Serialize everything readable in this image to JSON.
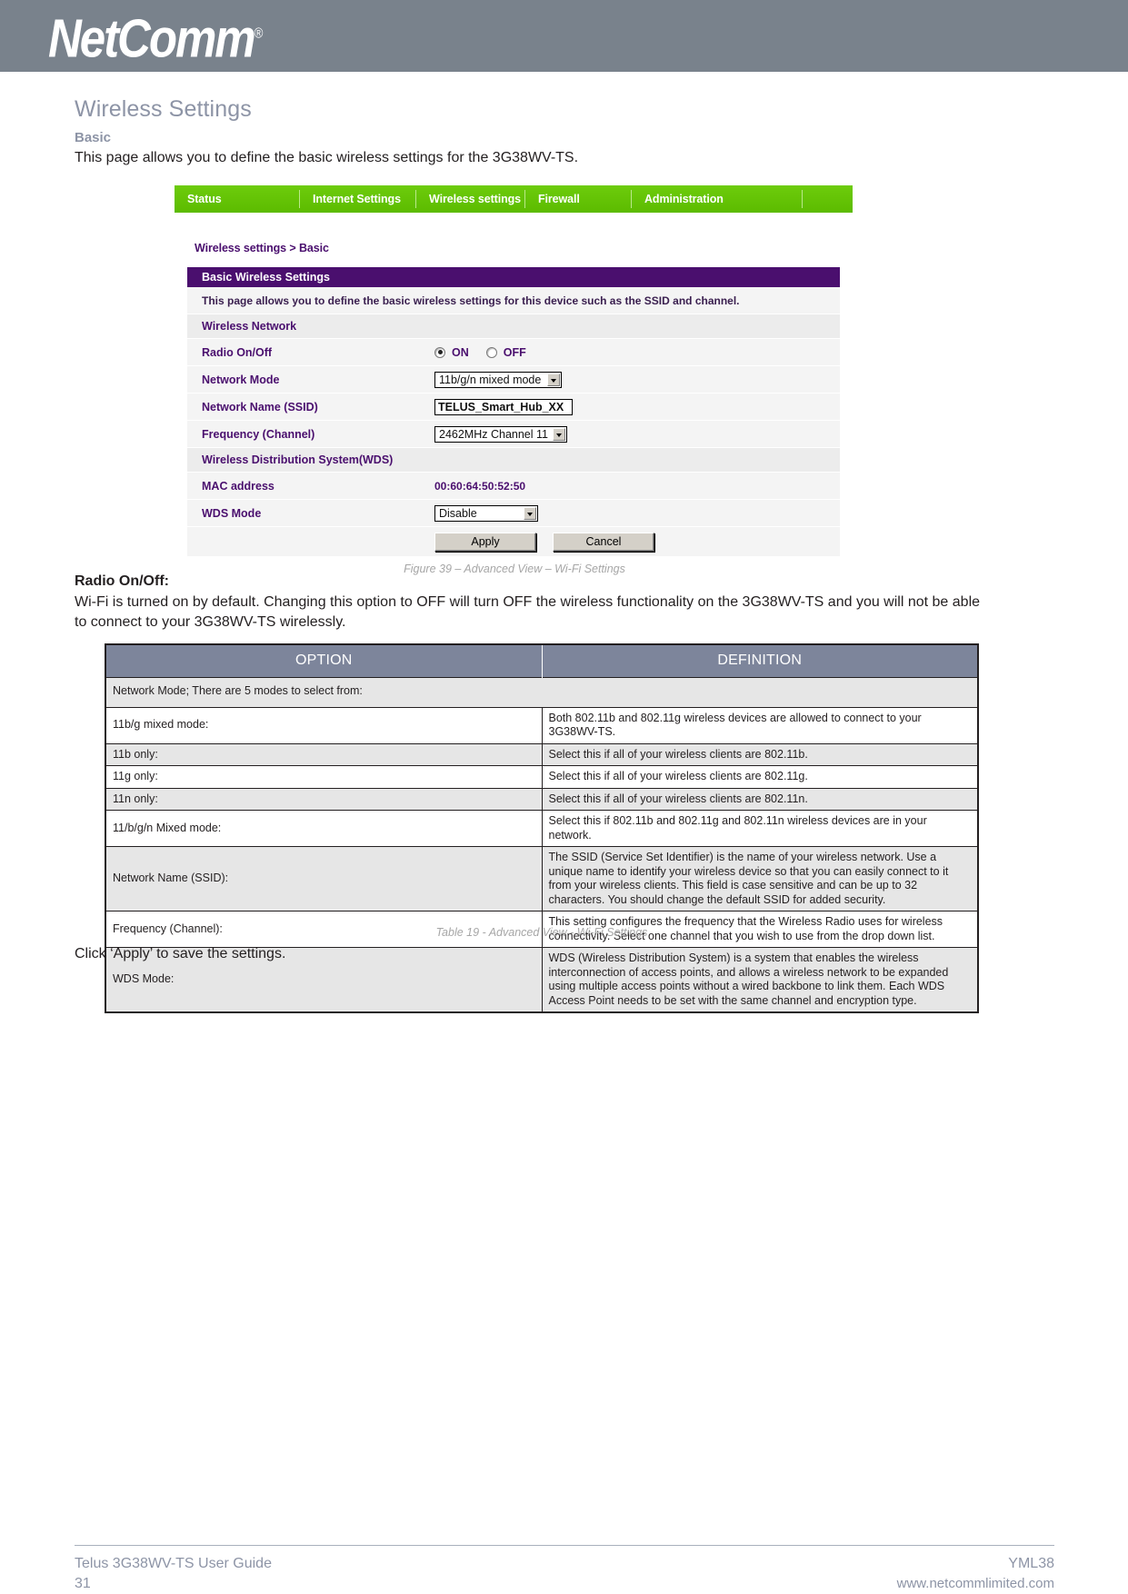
{
  "brand": {
    "logo_text": "NetComm",
    "registered_mark": "®",
    "band_color": "#79828c"
  },
  "document": {
    "page_title": "Wireless Settings",
    "section_subtitle": "Basic",
    "intro": "This page allows you to define the basic wireless settings for the 3G38WV-TS.",
    "figure_caption": "Figure 39 – Advanced View – Wi-Fi Settings",
    "table_caption": "Table 19 - Advanced View - Wi-Fi Settings",
    "lead_heading": "Radio On/Off:",
    "lead_body": "Wi-Fi is turned on by default. Changing this option to OFF will turn OFF the wireless functionality on the 3G38WV-TS and you will not be able to connect to your 3G38WV-TS wirelessly.",
    "closing_line": "Click ‘Apply’ to save the settings."
  },
  "router_ui": {
    "nav": [
      {
        "label": "Status"
      },
      {
        "label": "Internet Settings"
      },
      {
        "label": "Wireless settings"
      },
      {
        "label": "Firewall"
      },
      {
        "label": "Administration"
      },
      {
        "label": ""
      }
    ],
    "nav_color": "#66cc00",
    "breadcrumb": "Wireless settings > Basic",
    "panel_title": "Basic Wireless Settings",
    "panel_title_color": "#4a0f6e",
    "panel_description": "This page allows you to define the basic wireless settings for this device such as the SSID and channel.",
    "sections": {
      "wireless_network": "Wireless Network",
      "wds": "Wireless Distribution System(WDS)"
    },
    "fields": {
      "radio_label": "Radio On/Off",
      "radio_on": "ON",
      "radio_off": "OFF",
      "radio_selected": "ON",
      "network_mode_label": "Network Mode",
      "network_mode_value": "11b/g/n mixed mode",
      "ssid_label": "Network Name (SSID)",
      "ssid_value": "TELUS_Smart_Hub_XX",
      "frequency_label": "Frequency (Channel)",
      "frequency_value": "2462MHz Channel 11",
      "mac_label": "MAC address",
      "mac_value": "00:60:64:50:52:50",
      "wds_mode_label": "WDS Mode",
      "wds_mode_value": "Disable"
    },
    "buttons": {
      "apply": "Apply",
      "cancel": "Cancel"
    }
  },
  "definition_table": {
    "headers": [
      "OPTION",
      "DEFINITION"
    ],
    "group_row": "Network Mode; There are 5 modes to select from:",
    "rows": [
      {
        "option": "11b/g mixed mode:",
        "definition": "Both 802.11b and 802.11g wireless devices are allowed to connect to your 3G38WV-TS."
      },
      {
        "option": "11b only:",
        "definition": "Select this if all of your wireless clients are 802.11b."
      },
      {
        "option": "11g only:",
        "definition": "Select this if all of your wireless clients are 802.11g."
      },
      {
        "option": "11n only:",
        "definition": "Select this if all of your wireless clients are 802.11n."
      },
      {
        "option": "11/b/g/n Mixed mode:",
        "definition": "Select this if 802.11b and 802.11g and 802.11n wireless devices are in your network."
      },
      {
        "option": "Network Name (SSID):",
        "definition": "The SSID (Service Set Identifier) is the name of your wireless network. Use a unique name to identify your wireless device so that you can easily connect to it from your wireless clients. This field is case sensitive and can be up to 32 characters. You should change the default SSID for added security."
      },
      {
        "option": "Frequency (Channel):",
        "definition": "This setting configures the frequency that the Wireless Radio uses for wireless connectivity. Select one channel that you wish to use from the drop down list."
      },
      {
        "option": "WDS Mode:",
        "definition": "WDS (Wireless Distribution System) is a system that enables the wireless interconnection of access points, and allows a wireless network to be expanded using multiple access points without a wired backbone to link them. Each WDS Access Point needs to be set with the same channel and encryption type."
      }
    ],
    "header_color": "#7d859b",
    "shade_color": "#e6e6e6"
  },
  "footer": {
    "guide_title": "Telus 3G38WV-TS User Guide",
    "page_number": "31",
    "doc_code": "YML38",
    "website": "www.netcommlimited.com"
  }
}
